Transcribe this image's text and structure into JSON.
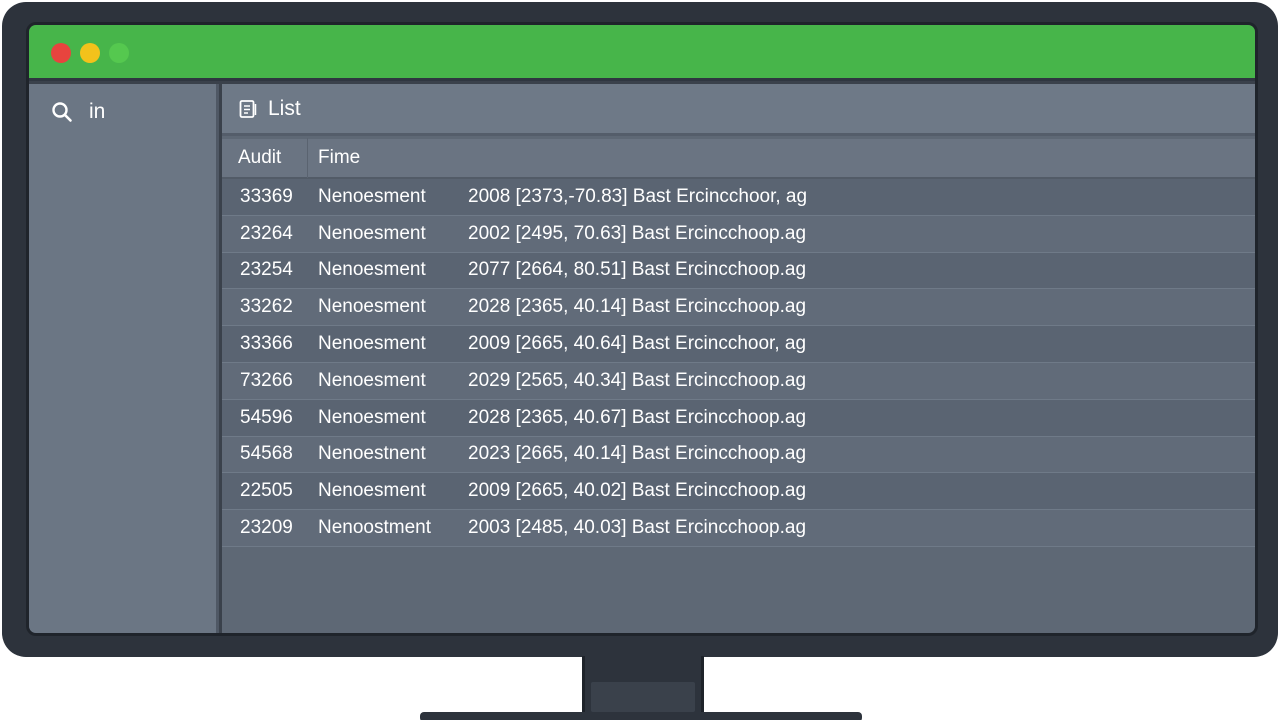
{
  "window": {
    "controls": [
      "close",
      "minimize",
      "maximize"
    ],
    "colors": {
      "titlebar": "#47b54a",
      "close": "#e8443e",
      "minimize": "#f2c21b",
      "maximize": "#55c84f"
    }
  },
  "sidebar": {
    "search": {
      "icon": "search-icon",
      "value": "in"
    }
  },
  "list": {
    "icon": "document-icon",
    "title": "List",
    "columns": [
      "Audit",
      "Fime"
    ],
    "rows": [
      {
        "id": "33369",
        "name": "Nenoesment",
        "detail": "2008 [2373,-70.83] Bast Ercincchoor, ag"
      },
      {
        "id": "23264",
        "name": "Nenoesment",
        "detail": "2002 [2495, 70.63] Bast Ercincchoop.ag"
      },
      {
        "id": "23254",
        "name": "Nenoesment",
        "detail": "2077 [2664, 80.51] Bast Ercincchoop.ag"
      },
      {
        "id": "33262",
        "name": "Nenoesment",
        "detail": "2028 [2365, 40.14] Bast Ercincchoop.ag"
      },
      {
        "id": "33366",
        "name": "Nenoesment",
        "detail": "2009 [2665, 40.64] Bast Ercincchoor, ag"
      },
      {
        "id": "73266",
        "name": "Nenoesment",
        "detail": "2029 [2565, 40.34] Bast Ercincchoop.ag"
      },
      {
        "id": "54596",
        "name": "Nenoesment",
        "detail": "2028 [2365, 40.67] Bast Ercincchoop.ag"
      },
      {
        "id": "54568",
        "name": "Nenoestnent",
        "detail": "2023 [2665, 40.14] Bast Ercincchoop.ag"
      },
      {
        "id": "22505",
        "name": "Nenoesment",
        "detail": "2009 [2665, 40.02] Bast Ercincchoop.ag"
      },
      {
        "id": "23209",
        "name": "Nenoostment",
        "detail": "2003 [2485, 40.03] Bast Ercincchoop.ag"
      }
    ]
  }
}
